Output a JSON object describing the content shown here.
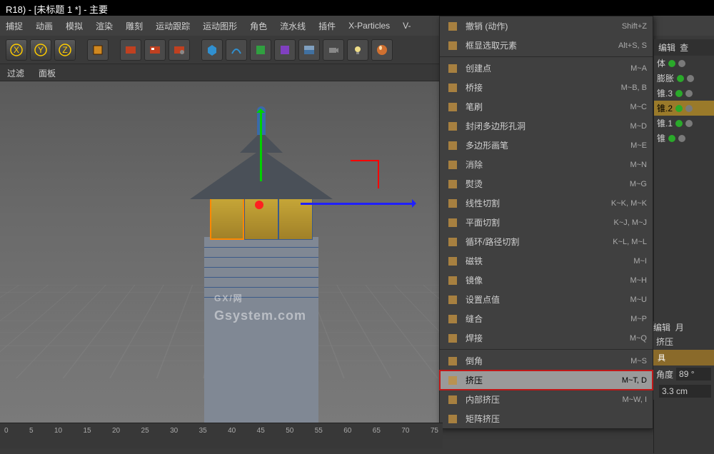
{
  "title": "R18) - [未标题 1 *] - 主要",
  "menubar": [
    "捕捉",
    "动画",
    "模拟",
    "渲染",
    "雕刻",
    "运动跟踪",
    "运动图形",
    "角色",
    "流水线",
    "插件",
    "X-Particles",
    "V-"
  ],
  "subbar": [
    "过滤",
    "面板"
  ],
  "context_menu": [
    {
      "icon": "undo",
      "label": "撤销 (动作)",
      "shortcut": "Shift+Z"
    },
    {
      "icon": "select",
      "label": "框显选取元素",
      "shortcut": "Alt+S, S"
    },
    {
      "divider": true
    },
    {
      "icon": "point",
      "label": "创建点",
      "shortcut": "M~A"
    },
    {
      "icon": "bridge",
      "label": "桥接",
      "shortcut": "M~B, B"
    },
    {
      "icon": "brush",
      "label": "笔刷",
      "shortcut": "M~C"
    },
    {
      "icon": "close-hole",
      "label": "封闭多边形孔洞",
      "shortcut": "M~D"
    },
    {
      "icon": "poly-pen",
      "label": "多边形画笔",
      "shortcut": "M~E"
    },
    {
      "icon": "dissolve",
      "label": "消除",
      "shortcut": "M~N"
    },
    {
      "icon": "iron",
      "label": "熨烫",
      "shortcut": "M~G"
    },
    {
      "icon": "knife-line",
      "label": "线性切割",
      "shortcut": "K~K, M~K"
    },
    {
      "icon": "knife-plane",
      "label": "平面切割",
      "shortcut": "K~J, M~J"
    },
    {
      "icon": "loop-cut",
      "label": "循环/路径切割",
      "shortcut": "K~L, M~L"
    },
    {
      "icon": "magnet",
      "label": "磁铁",
      "shortcut": "M~I"
    },
    {
      "icon": "mirror",
      "label": "镜像",
      "shortcut": "M~H"
    },
    {
      "icon": "set-point",
      "label": "设置点值",
      "shortcut": "M~U"
    },
    {
      "icon": "stitch",
      "label": "缝合",
      "shortcut": "M~P"
    },
    {
      "icon": "weld",
      "label": "焊接",
      "shortcut": "M~Q"
    },
    {
      "divider": true
    },
    {
      "icon": "bevel",
      "label": "倒角",
      "shortcut": "M~S"
    },
    {
      "icon": "extrude",
      "label": "挤压",
      "shortcut": "M~T, D",
      "highlighted": true
    },
    {
      "icon": "inner-extrude",
      "label": "内部挤压",
      "shortcut": "M~W, I"
    },
    {
      "icon": "matrix-extrude",
      "label": "矩阵挤压",
      "shortcut": ""
    }
  ],
  "right_header_tabs": [
    "编辑",
    "查"
  ],
  "objects": [
    {
      "name": "体",
      "sel": false
    },
    {
      "name": "膨胀",
      "sel": false
    },
    {
      "name": "锥.3",
      "sel": false
    },
    {
      "name": "锥.2",
      "sel": true
    },
    {
      "name": "锥.1",
      "sel": false
    },
    {
      "name": "锥",
      "sel": false
    }
  ],
  "attr_header_tabs": [
    "编辑",
    "月"
  ],
  "attr_section": "挤压",
  "attr_tool_tab": "具",
  "attributes": [
    {
      "label": "角度",
      "value": "89 °"
    },
    {
      "label": "",
      "value": "3.3 cm"
    }
  ],
  "timeline_ticks": [
    "0",
    "5",
    "10",
    "15",
    "20",
    "25",
    "30",
    "35",
    "40",
    "45",
    "50",
    "55",
    "60",
    "65",
    "70",
    "75"
  ],
  "watermark": {
    "big": "GX/网",
    "small": "Gsystem.com"
  }
}
